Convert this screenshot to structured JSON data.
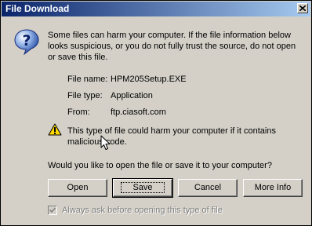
{
  "window": {
    "title": "File Download"
  },
  "icons": {
    "title_close": "close-icon",
    "dialog": "question-icon",
    "warning": "warning-icon"
  },
  "intro_text": "Some files can harm your computer. If the file information below looks suspicious, or you do not fully trust the source, do not open or save this file.",
  "file_info": {
    "name_label": "File name:",
    "name_value": "HPM205Setup.EXE",
    "type_label": "File type:",
    "type_value": "Application",
    "from_label": "From:",
    "from_value": "ftp.ciasoft.com"
  },
  "warning_text": "This type of file could harm your computer if it contains malicious code.",
  "question_text": "Would you like to open the file or save it to your computer?",
  "buttons": {
    "open": "Open",
    "save": "Save",
    "cancel": "Cancel",
    "more_info": "More Info"
  },
  "checkbox": {
    "label": "Always ask before opening this type of file",
    "checked": true,
    "disabled": true
  },
  "colors": {
    "title_start": "#0a246a",
    "title_end": "#a6caf0",
    "face": "#d4d0c8"
  }
}
